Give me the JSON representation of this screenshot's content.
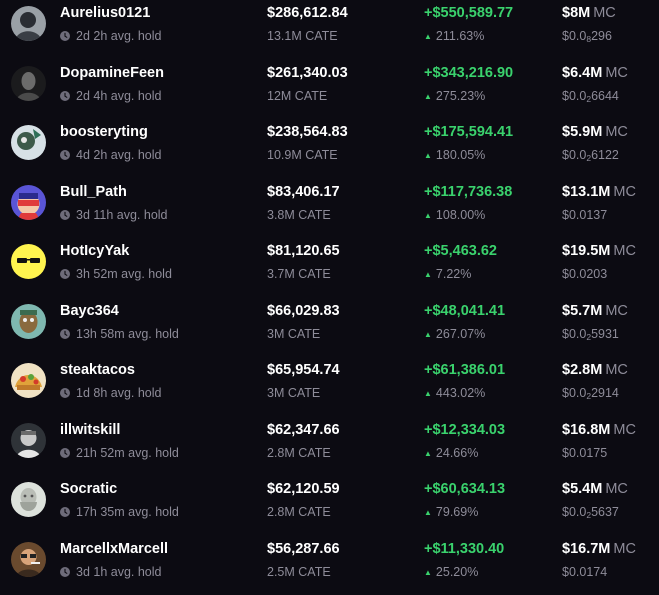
{
  "colors": {
    "background": "#0c0b12",
    "positive": "#3ad26d",
    "muted": "#8e8c99"
  },
  "icons": {
    "hold": "clock-icon",
    "trend": "triangle-up-icon"
  },
  "traders": [
    {
      "name": "Aurelius0121",
      "hold": "2d 2h avg. hold",
      "value": "$286,612.84",
      "tokens": "13.1M CATE",
      "pnl": "+$550,589.77",
      "pct": "211.63%",
      "mc": "$8M",
      "mc_label": "MC",
      "price_prefix": "$0.0",
      "price_sub": "8",
      "price_rest": "296",
      "avatar": "a1"
    },
    {
      "name": "DopamineFeen",
      "hold": "2d 4h avg. hold",
      "value": "$261,340.03",
      "tokens": "12M CATE",
      "pnl": "+$343,216.90",
      "pct": "275.23%",
      "mc": "$6.4M",
      "mc_label": "MC",
      "price_prefix": "$0.0",
      "price_sub": "2",
      "price_rest": "6644",
      "avatar": "a2"
    },
    {
      "name": "boosteryting",
      "hold": "4d 2h avg. hold",
      "value": "$238,564.83",
      "tokens": "10.9M CATE",
      "pnl": "+$175,594.41",
      "pct": "180.05%",
      "mc": "$5.9M",
      "mc_label": "MC",
      "price_prefix": "$0.0",
      "price_sub": "2",
      "price_rest": "6122",
      "avatar": "a3"
    },
    {
      "name": "Bull_Path",
      "hold": "3d 11h avg. hold",
      "value": "$83,406.17",
      "tokens": "3.8M CATE",
      "pnl": "+$117,736.38",
      "pct": "108.00%",
      "mc": "$13.1M",
      "mc_label": "MC",
      "price_prefix": "$0.0137",
      "price_sub": "",
      "price_rest": "",
      "avatar": "a4"
    },
    {
      "name": "HotIcyYak",
      "hold": "3h 52m avg. hold",
      "value": "$81,120.65",
      "tokens": "3.7M CATE",
      "pnl": "+$5,463.62",
      "pct": "7.22%",
      "mc": "$19.5M",
      "mc_label": "MC",
      "price_prefix": "$0.0203",
      "price_sub": "",
      "price_rest": "",
      "avatar": "a5"
    },
    {
      "name": "Bayc364",
      "hold": "13h 58m avg. hold",
      "value": "$66,029.83",
      "tokens": "3M CATE",
      "pnl": "+$48,041.41",
      "pct": "267.07%",
      "mc": "$5.7M",
      "mc_label": "MC",
      "price_prefix": "$0.0",
      "price_sub": "2",
      "price_rest": "5931",
      "avatar": "a6"
    },
    {
      "name": "steaktacos",
      "hold": "1d 8h avg. hold",
      "value": "$65,954.74",
      "tokens": "3M CATE",
      "pnl": "+$61,386.01",
      "pct": "443.02%",
      "mc": "$2.8M",
      "mc_label": "MC",
      "price_prefix": "$0.0",
      "price_sub": "2",
      "price_rest": "2914",
      "avatar": "a7"
    },
    {
      "name": "illwitskill",
      "hold": "21h 52m avg. hold",
      "value": "$62,347.66",
      "tokens": "2.8M CATE",
      "pnl": "+$12,334.03",
      "pct": "24.66%",
      "mc": "$16.8M",
      "mc_label": "MC",
      "price_prefix": "$0.0175",
      "price_sub": "",
      "price_rest": "",
      "avatar": "a8"
    },
    {
      "name": "Socratic",
      "hold": "17h 35m avg. hold",
      "value": "$62,120.59",
      "tokens": "2.8M CATE",
      "pnl": "+$60,634.13",
      "pct": "79.69%",
      "mc": "$5.4M",
      "mc_label": "MC",
      "price_prefix": "$0.0",
      "price_sub": "2",
      "price_rest": "5637",
      "avatar": "a9"
    },
    {
      "name": "MarcellxMarcell",
      "hold": "3d 1h avg. hold",
      "value": "$56,287.66",
      "tokens": "2.5M CATE",
      "pnl": "+$11,330.40",
      "pct": "25.20%",
      "mc": "$16.7M",
      "mc_label": "MC",
      "price_prefix": "$0.0174",
      "price_sub": "",
      "price_rest": "",
      "avatar": "a10"
    }
  ]
}
